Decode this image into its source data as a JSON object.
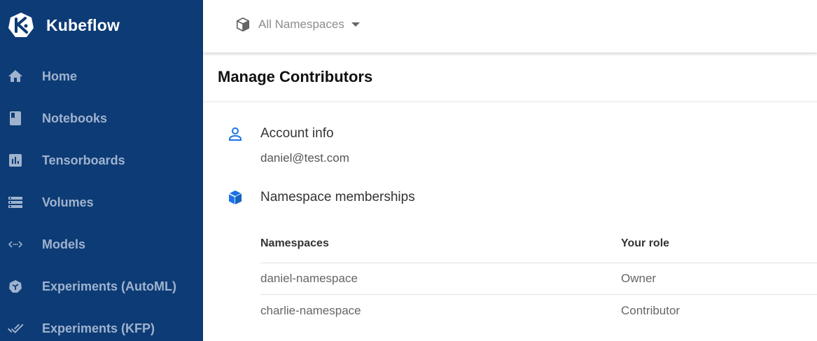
{
  "brand": {
    "name": "Kubeflow"
  },
  "sidebar": {
    "items": [
      {
        "label": "Home",
        "icon": "home-icon"
      },
      {
        "label": "Notebooks",
        "icon": "notebook-icon"
      },
      {
        "label": "Tensorboards",
        "icon": "assessment-icon"
      },
      {
        "label": "Volumes",
        "icon": "storage-icon"
      },
      {
        "label": "Models",
        "icon": "code-arrows-icon"
      },
      {
        "label": "Experiments (AutoML)",
        "icon": "automl-icon"
      },
      {
        "label": "Experiments (KFP)",
        "icon": "done-all-icon"
      }
    ]
  },
  "topbar": {
    "namespace_label": "All Namespaces"
  },
  "page": {
    "title": "Manage Contributors",
    "account": {
      "title": "Account info",
      "email": "daniel@test.com"
    },
    "memberships": {
      "title": "Namespace memberships",
      "columns": [
        "Namespaces",
        "Your role"
      ],
      "rows": [
        {
          "namespace": "daniel-namespace",
          "role": "Owner"
        },
        {
          "namespace": "charlie-namespace",
          "role": "Contributor"
        }
      ]
    }
  },
  "colors": {
    "sidebar_bg": "#0d3b75",
    "accent": "#1a73e8"
  }
}
